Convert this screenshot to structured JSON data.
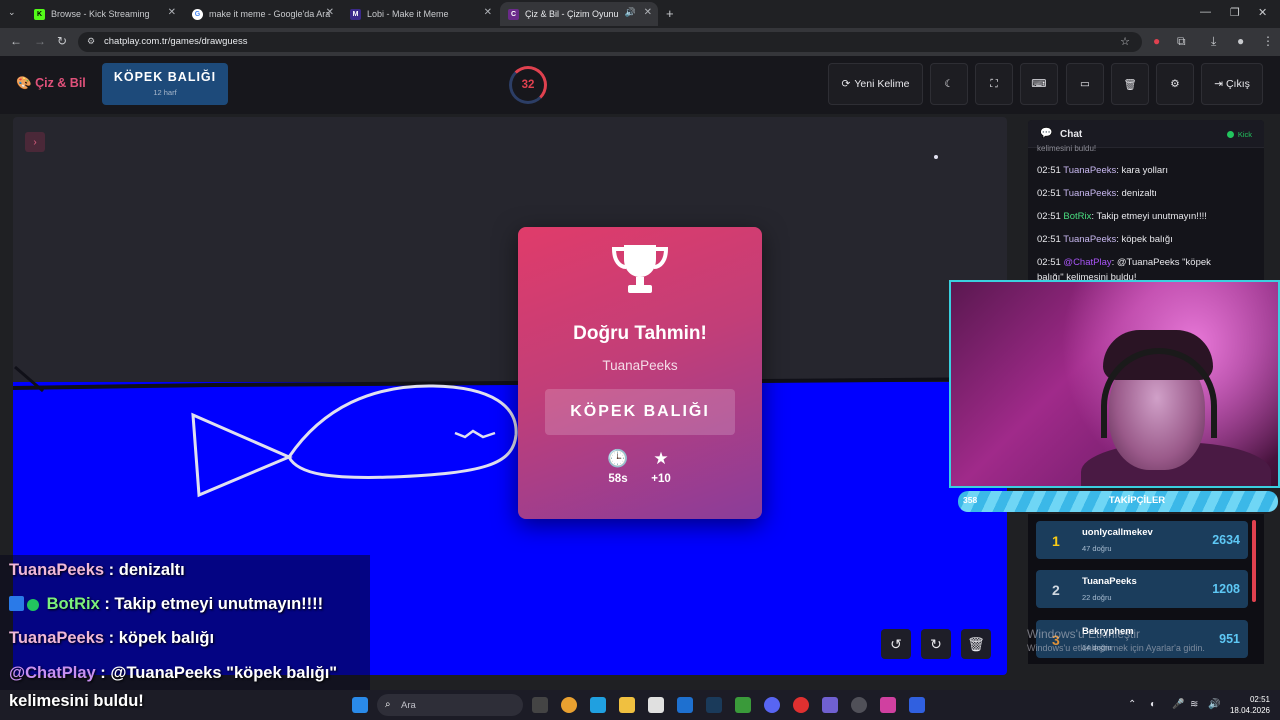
{
  "browser": {
    "tabs": [
      {
        "title": "Browse - Kick Streaming",
        "favicon": "kick-icon"
      },
      {
        "title": "make it meme - Google'da Ara",
        "favicon": "google-icon"
      },
      {
        "title": "Lobi - Make it Meme",
        "favicon": "mim-icon"
      },
      {
        "title": "Çiz & Bil - Çizim Oyunu",
        "favicon": "cp-icon",
        "active": true
      }
    ],
    "url": "chatplay.com.tr/games/drawguess"
  },
  "header": {
    "brand": "Çiz & Bil",
    "word": "KÖPEK BALIĞI",
    "word_hint": "12 harf",
    "timer": "32",
    "new_word": "Yeni Kelime",
    "exit": "Çıkış"
  },
  "result": {
    "title": "Doğru Tahmin!",
    "player": "TuanaPeeks",
    "answer": "KÖPEK BALIĞI",
    "time": "58s",
    "points": "+10"
  },
  "chat": {
    "title": "Chat",
    "source": "Kick",
    "top_fragment": "kelimesini buldu!",
    "messages": [
      {
        "time": "02:51",
        "user": "TuanaPeeks",
        "text": ": kara yolları"
      },
      {
        "time": "02:51",
        "user": "TuanaPeeks",
        "text": ": denizaltı"
      },
      {
        "time": "02:51",
        "user": "BotRix",
        "text": ": Takip etmeyi unutmayın!!!!"
      },
      {
        "time": "02:51",
        "user": "TuanaPeeks",
        "text": ": köpek balığı"
      },
      {
        "time": "02:51",
        "user": "@ChatPlay",
        "text": ": @TuanaPeeks \"köpek"
      },
      {
        "time": "",
        "user": "",
        "text": "balığı\" kelimesini buldu!"
      }
    ]
  },
  "followers": {
    "count": "358",
    "label": "TAKİPÇİLER"
  },
  "leaderboard": [
    {
      "rank": "1",
      "name": "uonlycallmekev",
      "sub": "47 doğru",
      "score": "2634"
    },
    {
      "rank": "2",
      "name": "TuanaPeeks",
      "sub": "22 doğru",
      "score": "1208"
    },
    {
      "rank": "3",
      "name": "Bekryphem",
      "sub": "14 doğru",
      "score": "951"
    }
  ],
  "watermark": {
    "line1": "Windows'u Etkinleştir",
    "line2": "Windows'u etkinleştirmek için Ayarlar'a gidin."
  },
  "overlay_chat": [
    {
      "user": "TuanaPeeks",
      "text": " : denizaltı"
    },
    {
      "user": "BotRix",
      "text": " : Takip etmeyi unutmayın!!!!"
    },
    {
      "user": "TuanaPeeks",
      "text": " : köpek balığı"
    },
    {
      "user": "@ChatPlay",
      "text": " : @TuanaPeeks \"köpek balığı\""
    },
    {
      "user": "",
      "text": "kelimesini buldu!"
    }
  ],
  "taskbar": {
    "search_placeholder": "Ara",
    "time": "02:51",
    "date": "18.04.2026"
  },
  "colors": {
    "accent": "#e0517a",
    "canvas_dark": "#26262e",
    "sea_blue": "#0000ff",
    "kick_green": "#22c55e"
  }
}
